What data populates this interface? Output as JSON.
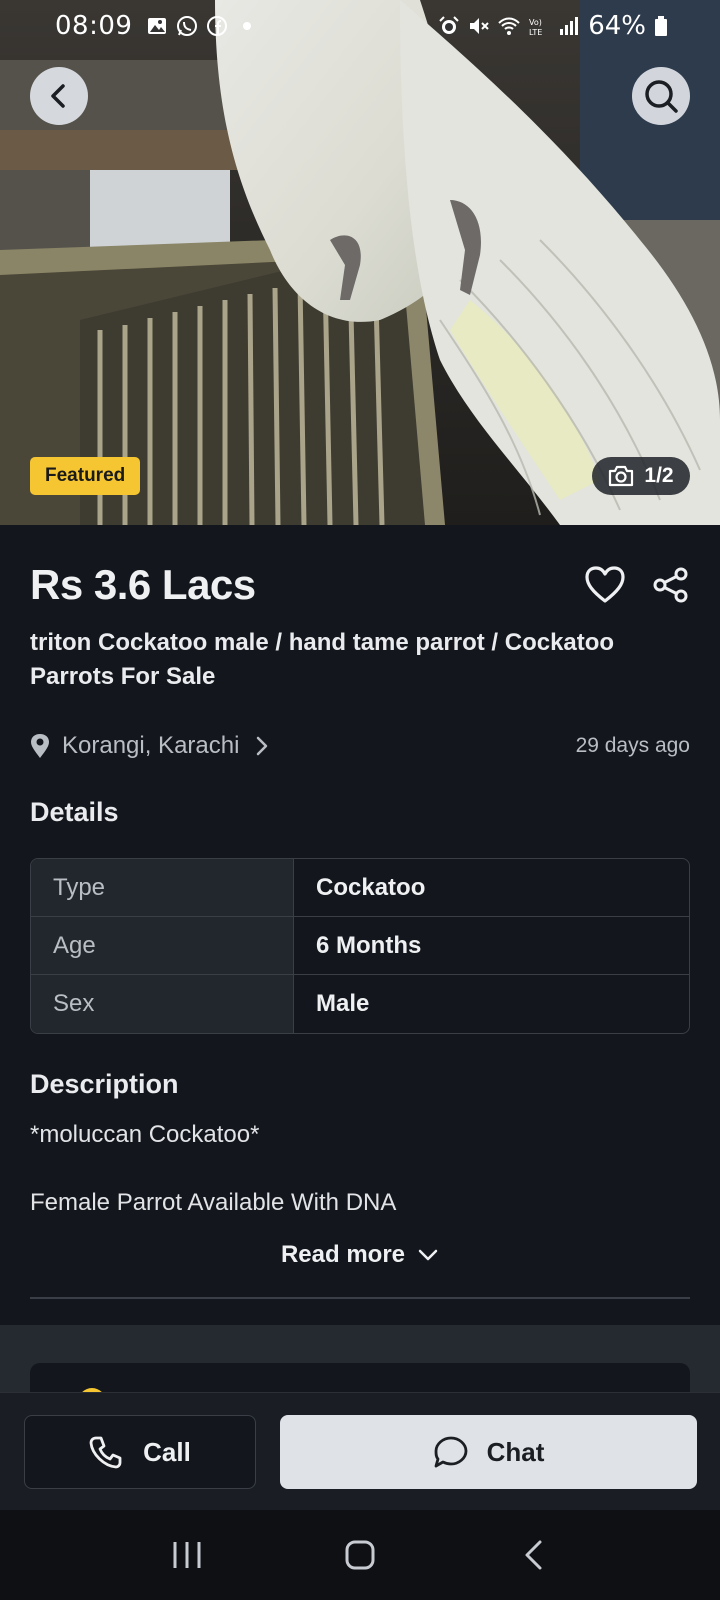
{
  "status_bar": {
    "time": "08:09",
    "battery": "64%",
    "left_icons": [
      "gallery-icon",
      "whatsapp-icon",
      "facebook-icon",
      "dot-icon"
    ],
    "right_icons": [
      "alarm-icon",
      "mute-icon",
      "wifi-icon",
      "volte-icon",
      "signal-icon",
      "battery-icon"
    ]
  },
  "hero": {
    "badge": "Featured",
    "image_counter": "1/2"
  },
  "listing": {
    "price": "Rs 3.6 Lacs",
    "title": "triton Cockatoo male / hand tame parrot / Cockatoo Parrots For Sale",
    "location": "Korangi, Karachi",
    "posted": "29 days ago"
  },
  "details": {
    "heading": "Details",
    "rows": [
      {
        "key": "Type",
        "value": "Cockatoo"
      },
      {
        "key": "Age",
        "value": "6 Months"
      },
      {
        "key": "Sex",
        "value": "Male"
      }
    ]
  },
  "description": {
    "heading": "Description",
    "line1": "*moluccan Cockatoo*",
    "line2": "Female Parrot Available With DNA",
    "read_more": "Read more"
  },
  "actions": {
    "call_label": "Call",
    "chat_label": "Chat"
  },
  "colors": {
    "background": "#13161c",
    "featured_badge": "#f5c631",
    "chat_button": "#dfe2e7"
  }
}
